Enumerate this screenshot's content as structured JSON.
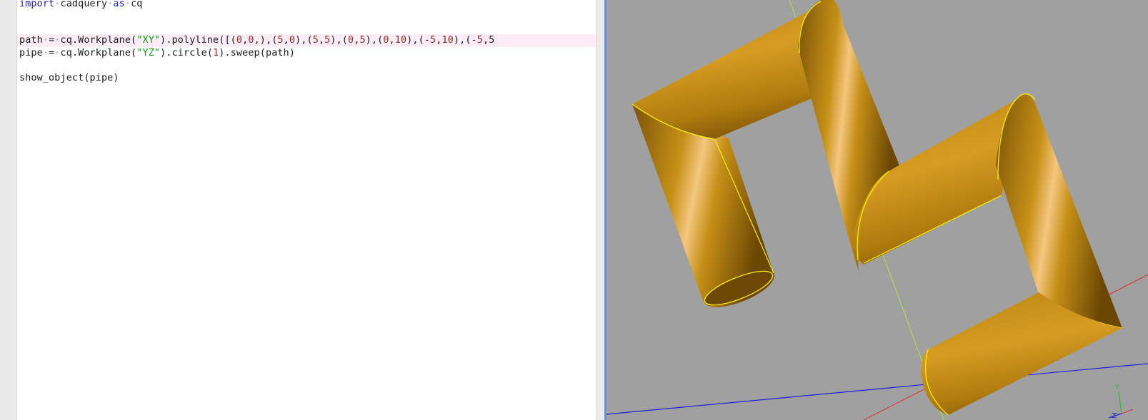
{
  "editor": {
    "lines": [
      {
        "tokens": [
          {
            "t": "import",
            "c": "kw"
          },
          {
            "t": "·",
            "c": "dot"
          },
          {
            "t": "cadquery",
            "c": ""
          },
          {
            "t": "·",
            "c": "dot"
          },
          {
            "t": "as",
            "c": "kw"
          },
          {
            "t": "·",
            "c": "dot"
          },
          {
            "t": "cq",
            "c": ""
          }
        ]
      },
      {
        "tokens": [
          {
            "t": "path",
            "c": ""
          },
          {
            "t": "·",
            "c": "dot"
          },
          {
            "t": "=",
            "c": ""
          },
          {
            "t": "·",
            "c": "dot"
          },
          {
            "t": "cq.Workplane(",
            "c": ""
          },
          {
            "t": "\"XY\"",
            "c": "str"
          },
          {
            "t": ").polyline([(",
            "c": ""
          },
          {
            "t": "0",
            "c": "num"
          },
          {
            "t": ",",
            "c": ""
          },
          {
            "t": "0",
            "c": "num"
          },
          {
            "t": ",),(",
            "c": ""
          },
          {
            "t": "5",
            "c": "num"
          },
          {
            "t": ",",
            "c": ""
          },
          {
            "t": "0",
            "c": "num"
          },
          {
            "t": "),(",
            "c": ""
          },
          {
            "t": "5",
            "c": "num"
          },
          {
            "t": ",",
            "c": ""
          },
          {
            "t": "5",
            "c": "num"
          },
          {
            "t": "),(",
            "c": ""
          },
          {
            "t": "0",
            "c": "num"
          },
          {
            "t": ",",
            "c": ""
          },
          {
            "t": "5",
            "c": "num"
          },
          {
            "t": "),(",
            "c": ""
          },
          {
            "t": "0",
            "c": "num"
          },
          {
            "t": ",",
            "c": ""
          },
          {
            "t": "10",
            "c": "num"
          },
          {
            "t": "),(-",
            "c": ""
          },
          {
            "t": "5",
            "c": "num"
          },
          {
            "t": ",",
            "c": ""
          },
          {
            "t": "10",
            "c": "num"
          },
          {
            "t": "),(-",
            "c": ""
          },
          {
            "t": "5",
            "c": "num"
          },
          {
            "t": ",5",
            "c": ""
          }
        ]
      },
      {
        "tokens": [
          {
            "t": "pipe",
            "c": ""
          },
          {
            "t": "·",
            "c": "dot"
          },
          {
            "t": "=",
            "c": ""
          },
          {
            "t": "·",
            "c": "dot"
          },
          {
            "t": "cq.Workplane(",
            "c": ""
          },
          {
            "t": "\"YZ\"",
            "c": "str"
          },
          {
            "t": ").circle(",
            "c": ""
          },
          {
            "t": "1",
            "c": "num"
          },
          {
            "t": ").sweep(path)",
            "c": ""
          }
        ]
      },
      {
        "tokens": [
          {
            "t": "show_object(pipe)",
            "c": ""
          }
        ]
      }
    ]
  },
  "viewport": {
    "background": "#a0a0a0",
    "pipe_color": "#c8901a",
    "edge_color": "#f5f000",
    "triad": {
      "y_label": "Y",
      "z_label": "Z"
    }
  }
}
